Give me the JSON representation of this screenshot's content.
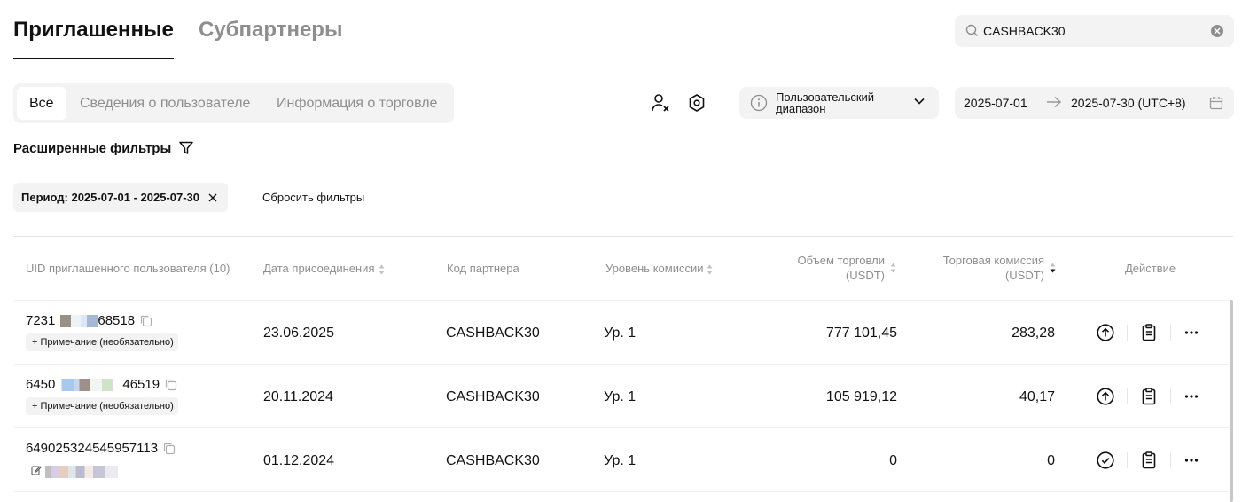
{
  "top_tabs": [
    {
      "label": "Приглашенные",
      "active": true
    },
    {
      "label": "Субпартнеры",
      "active": false
    }
  ],
  "search": {
    "value": "CASHBACK30",
    "icon": "search-icon",
    "clear_icon": "clear-icon"
  },
  "segment_tabs": [
    {
      "label": "Все",
      "active": true
    },
    {
      "label": "Сведения о пользователе",
      "active": false
    },
    {
      "label": "Информация о торговле",
      "active": false
    }
  ],
  "toolbar_icons": [
    "user-remove-icon",
    "settings-hexagon-icon"
  ],
  "range_select": {
    "label": "Пользовательский диапазон",
    "icon": "info-icon"
  },
  "date_range": {
    "start": "2025-07-01",
    "end": "2025-07-30 (UTC+8)",
    "icon": "calendar-icon"
  },
  "advanced_filters": {
    "label": "Расширенные фильтры",
    "icon": "filter-icon"
  },
  "active_filter": {
    "label": "Период: 2025-07-01 - 2025-07-30"
  },
  "reset_filters_label": "Сбросить фильтры",
  "table": {
    "headers": {
      "uid": "UID приглашенного пользователя (10)",
      "join_date": "Дата присоединения",
      "partner_code": "Код партнера",
      "commission_level": "Уровень комиссии",
      "trade_volume_l1": "Объем торговли",
      "trade_volume_l2": "(USDT)",
      "trade_fee_l1": "Торговая комиссия",
      "trade_fee_l2": "(USDT)",
      "action": "Действие"
    },
    "rows": [
      {
        "uid_start": "7231",
        "uid_end": "68518",
        "note": "+ Примечание (необязательно)",
        "join_date": "23.06.2025",
        "partner_code": "CASHBACK30",
        "level": "Ур. 1",
        "volume": "777 101,45",
        "fee": "283,28",
        "status_icon": "arrow-up-circle-icon"
      },
      {
        "uid_start": "6450",
        "uid_end": "46519",
        "note": "+ Примечание (необязательно)",
        "join_date": "20.11.2024",
        "partner_code": "CASHBACK30",
        "level": "Ур. 1",
        "volume": "105 919,12",
        "fee": "40,17",
        "status_icon": "arrow-up-circle-icon"
      },
      {
        "uid_full": "649025324545957113",
        "join_date": "01.12.2024",
        "partner_code": "CASHBACK30",
        "level": "Ур. 1",
        "volume": "0",
        "fee": "0",
        "status_icon": "check-circle-icon"
      }
    ]
  },
  "colors": {
    "text": "#121212",
    "muted": "#8e8e8e",
    "surface": "#f3f3f3",
    "border": "#e6e6e6"
  }
}
